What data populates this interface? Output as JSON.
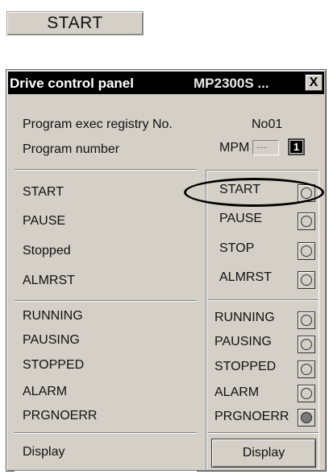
{
  "top_button": {
    "label": "START"
  },
  "window": {
    "title": "Drive control panel",
    "model": "MP2300S  ...",
    "close_glyph": "X"
  },
  "info": {
    "registry_label": "Program exec registry No.",
    "registry_value": "No01",
    "program_label": "Program number",
    "mpm_label": "MPM",
    "mpm_value": "---",
    "spin_icon": "spin-icon"
  },
  "commands": [
    {
      "label": "START",
      "button_label": "START"
    },
    {
      "label": "PAUSE",
      "button_label": "PAUSE"
    },
    {
      "label": "Stopped",
      "button_label": "STOP"
    },
    {
      "label": "ALMRST",
      "button_label": "ALMRST"
    }
  ],
  "statuses": [
    {
      "label": "RUNNING",
      "indicator_label": "RUNNING",
      "lit": false
    },
    {
      "label": "PAUSING",
      "indicator_label": "PAUSING",
      "lit": false
    },
    {
      "label": "STOPPED",
      "indicator_label": "STOPPED",
      "lit": false
    },
    {
      "label": "ALARM",
      "indicator_label": "ALARM",
      "lit": false
    },
    {
      "label": "PRGNOERR",
      "indicator_label": "PRGNOERR",
      "lit": true
    }
  ],
  "display": {
    "label": "Display",
    "button_label": "Display"
  },
  "colors": {
    "titlebar": "#000000",
    "panel": "#d4d0c8",
    "indicator_lit": "#7a7a7a"
  }
}
